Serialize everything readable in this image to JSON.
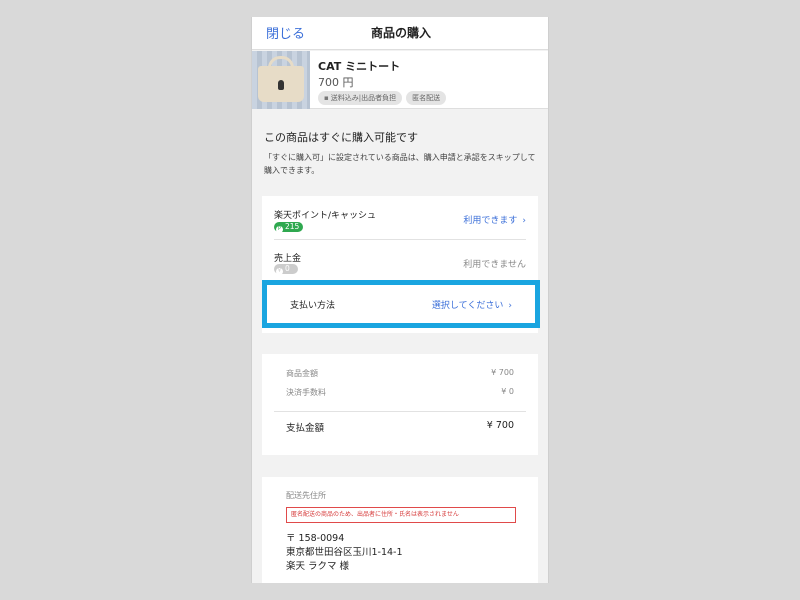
{
  "nav": {
    "close": "閉じる",
    "title": "商品の購入"
  },
  "product": {
    "name": "CAT ミニトート",
    "price": "700 円",
    "tags": [
      "送料込み|出品者負担",
      "匿名配送"
    ]
  },
  "notice": {
    "title": "この商品はすぐに購入可能です",
    "body": "「すぐに購入可」に設定されている商品は、購入申請と承認をスキップして購入できます。"
  },
  "payment": {
    "points": {
      "label": "楽天ポイント/キャッシュ",
      "value": "215",
      "action": "利用できます"
    },
    "sales": {
      "label": "売上金",
      "value": "0",
      "action": "利用できません"
    },
    "method": {
      "label": "支払い方法",
      "action": "選択してください"
    }
  },
  "summary": {
    "item_label": "商品金額",
    "item_value": "¥ 700",
    "fee_label": "決済手数料",
    "fee_value": "¥ 0",
    "total_label": "支払金額",
    "total_value": "¥ 700"
  },
  "shipping": {
    "header": "配送先住所",
    "warning": "匿名配送の商品のため、出品者に住所・氏名は表示されません",
    "postal": "〒 158-0094",
    "address": "東京都世田谷区玉川1-14-1",
    "name": "楽天 ラクマ 様"
  },
  "colors": {
    "accent": "#3b6fd9",
    "highlight": "#1aa5e0",
    "points": "#2fa84f",
    "warning": "#e04a4a"
  }
}
